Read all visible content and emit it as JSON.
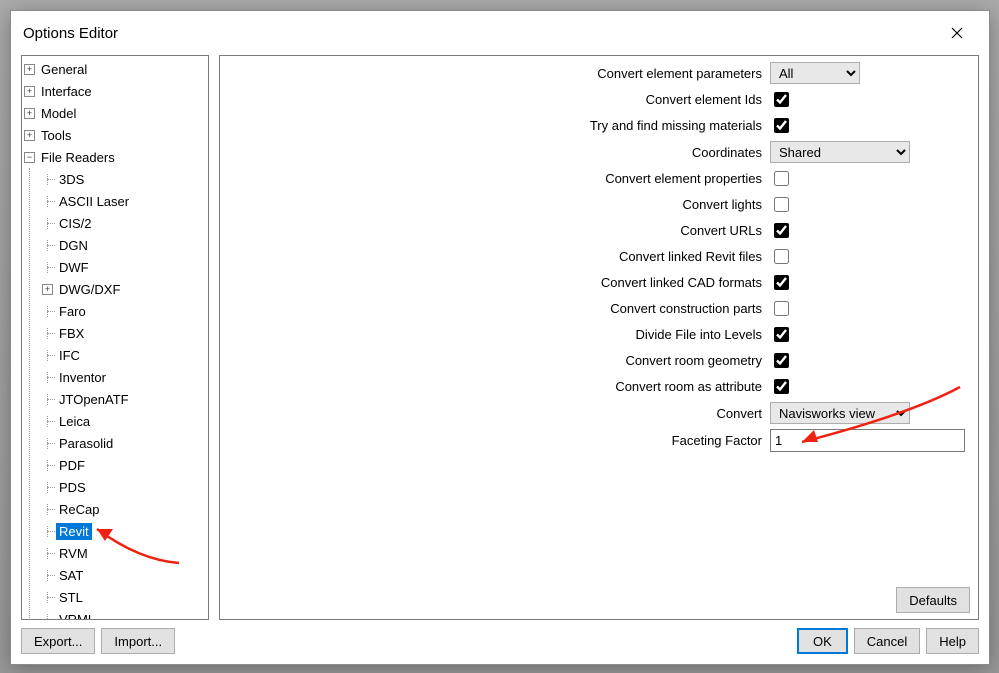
{
  "dialog": {
    "title": "Options Editor"
  },
  "tree": {
    "top": [
      {
        "label": "General",
        "expandable": true,
        "expanded": false
      },
      {
        "label": "Interface",
        "expandable": true,
        "expanded": false
      },
      {
        "label": "Model",
        "expandable": true,
        "expanded": false
      },
      {
        "label": "Tools",
        "expandable": true,
        "expanded": false
      }
    ],
    "filereaders_label": "File Readers",
    "filereaders": [
      {
        "label": "3DS"
      },
      {
        "label": "ASCII Laser"
      },
      {
        "label": "CIS/2"
      },
      {
        "label": "DGN"
      },
      {
        "label": "DWF"
      },
      {
        "label": "DWG/DXF",
        "expandable": true
      },
      {
        "label": "Faro"
      },
      {
        "label": "FBX"
      },
      {
        "label": "IFC"
      },
      {
        "label": "Inventor"
      },
      {
        "label": "JTOpenATF"
      },
      {
        "label": "Leica"
      },
      {
        "label": "Parasolid"
      },
      {
        "label": "PDF"
      },
      {
        "label": "PDS"
      },
      {
        "label": "ReCap"
      },
      {
        "label": "Revit",
        "selected": true
      },
      {
        "label": "RVM"
      },
      {
        "label": "SAT"
      },
      {
        "label": "STL"
      },
      {
        "label": "VRML"
      }
    ]
  },
  "form": {
    "rows": [
      {
        "label": "Convert element parameters",
        "type": "select",
        "value": "All",
        "width": "small"
      },
      {
        "label": "Convert element Ids",
        "type": "check",
        "checked": true
      },
      {
        "label": "Try and find missing materials",
        "type": "check",
        "checked": true
      },
      {
        "label": "Coordinates",
        "type": "select",
        "value": "Shared",
        "width": "med"
      },
      {
        "label": "Convert element properties",
        "type": "check",
        "checked": false
      },
      {
        "label": "Convert lights",
        "type": "check",
        "checked": false
      },
      {
        "label": "Convert URLs",
        "type": "check",
        "checked": true
      },
      {
        "label": "Convert linked Revit files",
        "type": "check",
        "checked": false
      },
      {
        "label": "Convert linked CAD formats",
        "type": "check",
        "checked": true
      },
      {
        "label": "Convert construction parts",
        "type": "check",
        "checked": false
      },
      {
        "label": "Divide File into Levels",
        "type": "check",
        "checked": true
      },
      {
        "label": "Convert room geometry",
        "type": "check",
        "checked": true
      },
      {
        "label": "Convert room as attribute",
        "type": "check",
        "checked": true
      },
      {
        "label": "Convert",
        "type": "select",
        "value": "Navisworks view",
        "width": "med"
      },
      {
        "label": "Faceting Factor",
        "type": "text",
        "value": "1"
      }
    ]
  },
  "buttons": {
    "defaults": "Defaults",
    "export": "Export...",
    "import": "Import...",
    "ok": "OK",
    "cancel": "Cancel",
    "help": "Help"
  }
}
